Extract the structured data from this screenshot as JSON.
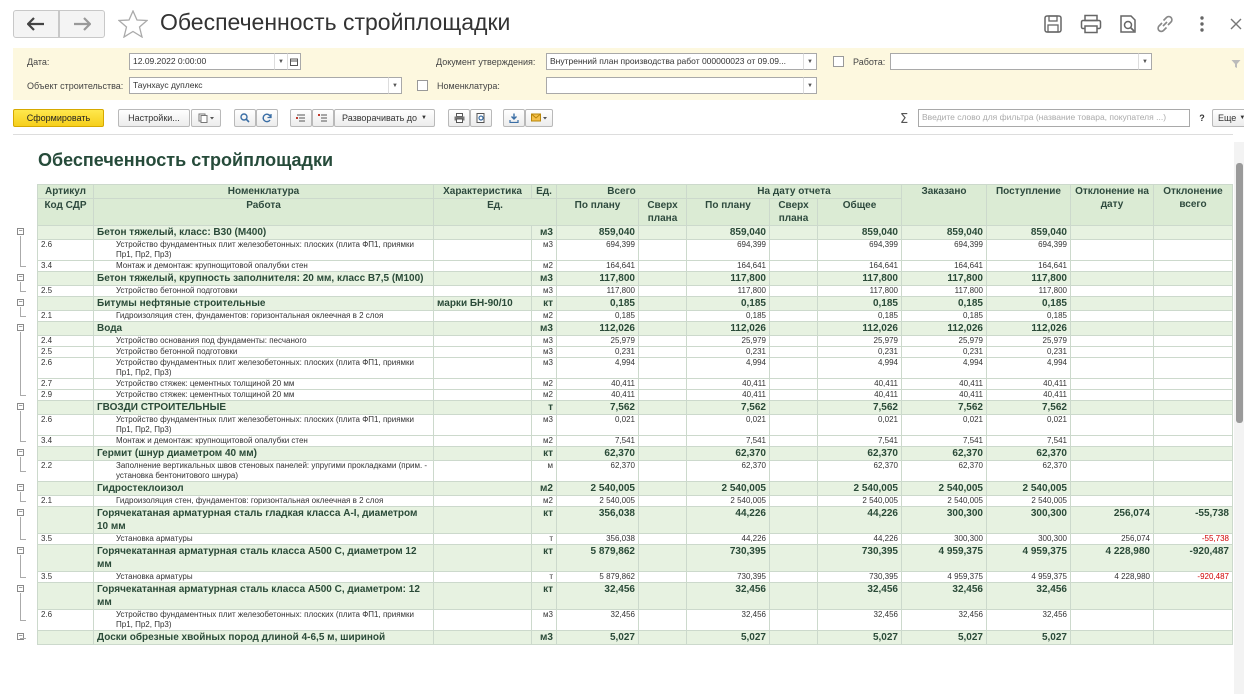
{
  "window": {
    "title": "Обеспеченность стройплощадки"
  },
  "filters": {
    "date_label": "Дата:",
    "date_value": "12.09.2022  0:00:00",
    "object_label": "Объект строительства:",
    "object_value": "Таунхаус дуплекс",
    "doc_label": "Документ утверждения:",
    "doc_value": "Внутренний план производства работ 000000023 от 09.09...",
    "nomen_label": "Номенклатура:",
    "nomen_value": "",
    "work_label": "Работа:",
    "work_value": ""
  },
  "toolbar": {
    "generate": "Сформировать",
    "settings": "Настройки...",
    "expand": "Разворачивать до",
    "filter_placeholder": "Введите слово для фильтра (название товара, покупателя ...)",
    "help": "?",
    "more": "Еще"
  },
  "report": {
    "title": "Обеспеченность стройплощадки",
    "headers": {
      "article": "Артикул",
      "sdr": "Код СДР",
      "nomen": "Номенклатура",
      "work": "Работа",
      "char": "Характеристика",
      "unit": "Ед.",
      "unit2": "Ед.",
      "total": "Всего",
      "onplan": "По плану",
      "overplan": "Сверх плана",
      "atdate": "На дату отчета",
      "onplan2": "По плану",
      "overplan2": "Сверх плана",
      "common": "Общее",
      "ordered": "Заказано",
      "received": "Поступление",
      "dev_date": "Отклонение на дату",
      "dev_total": "Отклонение всего"
    },
    "rows": [
      {
        "type": "grp",
        "code": "",
        "name": "Бетон тяжелый, класс: В30 (М400)",
        "char": "",
        "unit": "м3",
        "plan": "859,040",
        "over": "",
        "plan2": "859,040",
        "over2": "",
        "common": "859,040",
        "ordered": "859,040",
        "received": "859,040",
        "devdate": "",
        "devtotal": ""
      },
      {
        "type": "det",
        "code": "2.6",
        "name": "Устройство фундаментных плит железобетонных: плоских (плита ФП1, приямки Пр1, Пр2, Пр3)",
        "char": "",
        "unit": "м3",
        "plan": "694,399",
        "over": "",
        "plan2": "694,399",
        "over2": "",
        "common": "694,399",
        "ordered": "694,399",
        "received": "694,399",
        "devdate": "",
        "devtotal": ""
      },
      {
        "type": "det",
        "code": "3.4",
        "name": "Монтаж и демонтаж: крупнощитовой опалубки стен",
        "char": "",
        "unit": "м2",
        "plan": "164,641",
        "over": "",
        "plan2": "164,641",
        "over2": "",
        "common": "164,641",
        "ordered": "164,641",
        "received": "164,641",
        "devdate": "",
        "devtotal": ""
      },
      {
        "type": "grp",
        "code": "",
        "name": "Бетон тяжелый, крупность заполнителя: 20 мм, класс В7,5 (М100)",
        "char": "",
        "unit": "м3",
        "plan": "117,800",
        "over": "",
        "plan2": "117,800",
        "over2": "",
        "common": "117,800",
        "ordered": "117,800",
        "received": "117,800",
        "devdate": "",
        "devtotal": ""
      },
      {
        "type": "det",
        "code": "2.5",
        "name": "Устройство бетонной подготовки",
        "char": "",
        "unit": "м3",
        "plan": "117,800",
        "over": "",
        "plan2": "117,800",
        "over2": "",
        "common": "117,800",
        "ordered": "117,800",
        "received": "117,800",
        "devdate": "",
        "devtotal": ""
      },
      {
        "type": "grp",
        "code": "",
        "name": "Битумы нефтяные строительные",
        "char": "марки БН-90/10",
        "unit": "кт",
        "plan": "0,185",
        "over": "",
        "plan2": "0,185",
        "over2": "",
        "common": "0,185",
        "ordered": "0,185",
        "received": "0,185",
        "devdate": "",
        "devtotal": ""
      },
      {
        "type": "det",
        "code": "2.1",
        "name": "Гидроизоляция стен, фундаментов: горизонтальная оклеечная в 2 слоя",
        "char": "",
        "unit": "м2",
        "plan": "0,185",
        "over": "",
        "plan2": "0,185",
        "over2": "",
        "common": "0,185",
        "ordered": "0,185",
        "received": "0,185",
        "devdate": "",
        "devtotal": ""
      },
      {
        "type": "grp",
        "code": "",
        "name": "Вода",
        "char": "",
        "unit": "м3",
        "plan": "112,026",
        "over": "",
        "plan2": "112,026",
        "over2": "",
        "common": "112,026",
        "ordered": "112,026",
        "received": "112,026",
        "devdate": "",
        "devtotal": ""
      },
      {
        "type": "det",
        "code": "2.4",
        "name": "Устройство основания под фундаменты: песчаного",
        "char": "",
        "unit": "м3",
        "plan": "25,979",
        "over": "",
        "plan2": "25,979",
        "over2": "",
        "common": "25,979",
        "ordered": "25,979",
        "received": "25,979",
        "devdate": "",
        "devtotal": ""
      },
      {
        "type": "det",
        "code": "2.5",
        "name": "Устройство бетонной подготовки",
        "char": "",
        "unit": "м3",
        "plan": "0,231",
        "over": "",
        "plan2": "0,231",
        "over2": "",
        "common": "0,231",
        "ordered": "0,231",
        "received": "0,231",
        "devdate": "",
        "devtotal": ""
      },
      {
        "type": "det",
        "code": "2.6",
        "name": "Устройство фундаментных плит железобетонных: плоских (плита ФП1, приямки Пр1, Пр2, Пр3)",
        "char": "",
        "unit": "м3",
        "plan": "4,994",
        "over": "",
        "plan2": "4,994",
        "over2": "",
        "common": "4,994",
        "ordered": "4,994",
        "received": "4,994",
        "devdate": "",
        "devtotal": ""
      },
      {
        "type": "det",
        "code": "2.7",
        "name": "Устройство стяжек: цементных толщиной 20 мм",
        "char": "",
        "unit": "м2",
        "plan": "40,411",
        "over": "",
        "plan2": "40,411",
        "over2": "",
        "common": "40,411",
        "ordered": "40,411",
        "received": "40,411",
        "devdate": "",
        "devtotal": ""
      },
      {
        "type": "det",
        "code": "2.9",
        "name": "Устройство стяжек: цементных толщиной 20 мм",
        "char": "",
        "unit": "м2",
        "plan": "40,411",
        "over": "",
        "plan2": "40,411",
        "over2": "",
        "common": "40,411",
        "ordered": "40,411",
        "received": "40,411",
        "devdate": "",
        "devtotal": ""
      },
      {
        "type": "grp",
        "code": "",
        "name": "ГВОЗДИ СТРОИТЕЛЬНЫЕ",
        "char": "",
        "unit": "т",
        "plan": "7,562",
        "over": "",
        "plan2": "7,562",
        "over2": "",
        "common": "7,562",
        "ordered": "7,562",
        "received": "7,562",
        "devdate": "",
        "devtotal": ""
      },
      {
        "type": "det",
        "code": "2.6",
        "name": "Устройство фундаментных плит железобетонных: плоских (плита ФП1, приямки Пр1, Пр2, Пр3)",
        "char": "",
        "unit": "м3",
        "plan": "0,021",
        "over": "",
        "plan2": "0,021",
        "over2": "",
        "common": "0,021",
        "ordered": "0,021",
        "received": "0,021",
        "devdate": "",
        "devtotal": ""
      },
      {
        "type": "det",
        "code": "3.4",
        "name": "Монтаж и демонтаж: крупнощитовой опалубки стен",
        "char": "",
        "unit": "м2",
        "plan": "7,541",
        "over": "",
        "plan2": "7,541",
        "over2": "",
        "common": "7,541",
        "ordered": "7,541",
        "received": "7,541",
        "devdate": "",
        "devtotal": ""
      },
      {
        "type": "grp",
        "code": "",
        "name": "Гермит (шнур диаметром 40 мм)",
        "char": "",
        "unit": "кт",
        "plan": "62,370",
        "over": "",
        "plan2": "62,370",
        "over2": "",
        "common": "62,370",
        "ordered": "62,370",
        "received": "62,370",
        "devdate": "",
        "devtotal": ""
      },
      {
        "type": "det",
        "code": "2.2",
        "name": "Заполнение вертикальных швов стеновых панелей: упругими прокладками (прим. - установка бентонитового шнура)",
        "char": "",
        "unit": "м",
        "plan": "62,370",
        "over": "",
        "plan2": "62,370",
        "over2": "",
        "common": "62,370",
        "ordered": "62,370",
        "received": "62,370",
        "devdate": "",
        "devtotal": ""
      },
      {
        "type": "grp",
        "code": "",
        "name": "Гидростеклоизол",
        "char": "",
        "unit": "м2",
        "plan": "2 540,005",
        "over": "",
        "plan2": "2 540,005",
        "over2": "",
        "common": "2 540,005",
        "ordered": "2 540,005",
        "received": "2 540,005",
        "devdate": "",
        "devtotal": ""
      },
      {
        "type": "det",
        "code": "2.1",
        "name": "Гидроизоляция стен, фундаментов: горизонтальная оклеечная в 2 слоя",
        "char": "",
        "unit": "м2",
        "plan": "2 540,005",
        "over": "",
        "plan2": "2 540,005",
        "over2": "",
        "common": "2 540,005",
        "ordered": "2 540,005",
        "received": "2 540,005",
        "devdate": "",
        "devtotal": ""
      },
      {
        "type": "grp",
        "code": "",
        "name": "Горячекатаная арматурная сталь гладкая класса А-I, диаметром 10 мм",
        "char": "",
        "unit": "кт",
        "plan": "356,038",
        "over": "",
        "plan2": "44,226",
        "over2": "",
        "common": "44,226",
        "ordered": "300,300",
        "received": "300,300",
        "devdate": "256,074",
        "devtotal": "-55,738"
      },
      {
        "type": "det",
        "code": "3.5",
        "name": "Установка арматуры",
        "char": "",
        "unit": "т",
        "plan": "356,038",
        "over": "",
        "plan2": "44,226",
        "over2": "",
        "common": "44,226",
        "ordered": "300,300",
        "received": "300,300",
        "devdate": "256,074",
        "devtotal": "-55,738"
      },
      {
        "type": "grp",
        "code": "",
        "name": "Горячекатанная арматурная сталь класса А500 С, диаметром 12 мм",
        "char": "",
        "unit": "кт",
        "plan": "5 879,862",
        "over": "",
        "plan2": "730,395",
        "over2": "",
        "common": "730,395",
        "ordered": "4 959,375",
        "received": "4 959,375",
        "devdate": "4 228,980",
        "devtotal": "-920,487"
      },
      {
        "type": "det",
        "code": "3.5",
        "name": "Установка арматуры",
        "char": "",
        "unit": "т",
        "plan": "5 879,862",
        "over": "",
        "plan2": "730,395",
        "over2": "",
        "common": "730,395",
        "ordered": "4 959,375",
        "received": "4 959,375",
        "devdate": "4 228,980",
        "devtotal": "-920,487"
      },
      {
        "type": "grp",
        "code": "",
        "name": "Горячекатанная арматурная сталь класса А500 С, диаметром: 12 мм",
        "char": "",
        "unit": "кт",
        "plan": "32,456",
        "over": "",
        "plan2": "32,456",
        "over2": "",
        "common": "32,456",
        "ordered": "32,456",
        "received": "32,456",
        "devdate": "",
        "devtotal": ""
      },
      {
        "type": "det",
        "code": "2.6",
        "name": "Устройство фундаментных плит железобетонных: плоских (плита ФП1, приямки Пр1, Пр2, Пр3)",
        "char": "",
        "unit": "м3",
        "plan": "32,456",
        "over": "",
        "plan2": "32,456",
        "over2": "",
        "common": "32,456",
        "ordered": "32,456",
        "received": "32,456",
        "devdate": "",
        "devtotal": ""
      },
      {
        "type": "grp",
        "code": "",
        "name": "Доски обрезные хвойных пород длиной 4-6,5 м, шириной",
        "char": "",
        "unit": "м3",
        "plan": "5,027",
        "over": "",
        "plan2": "5,027",
        "over2": "",
        "common": "5,027",
        "ordered": "5,027",
        "received": "5,027",
        "devdate": "",
        "devtotal": ""
      }
    ]
  }
}
